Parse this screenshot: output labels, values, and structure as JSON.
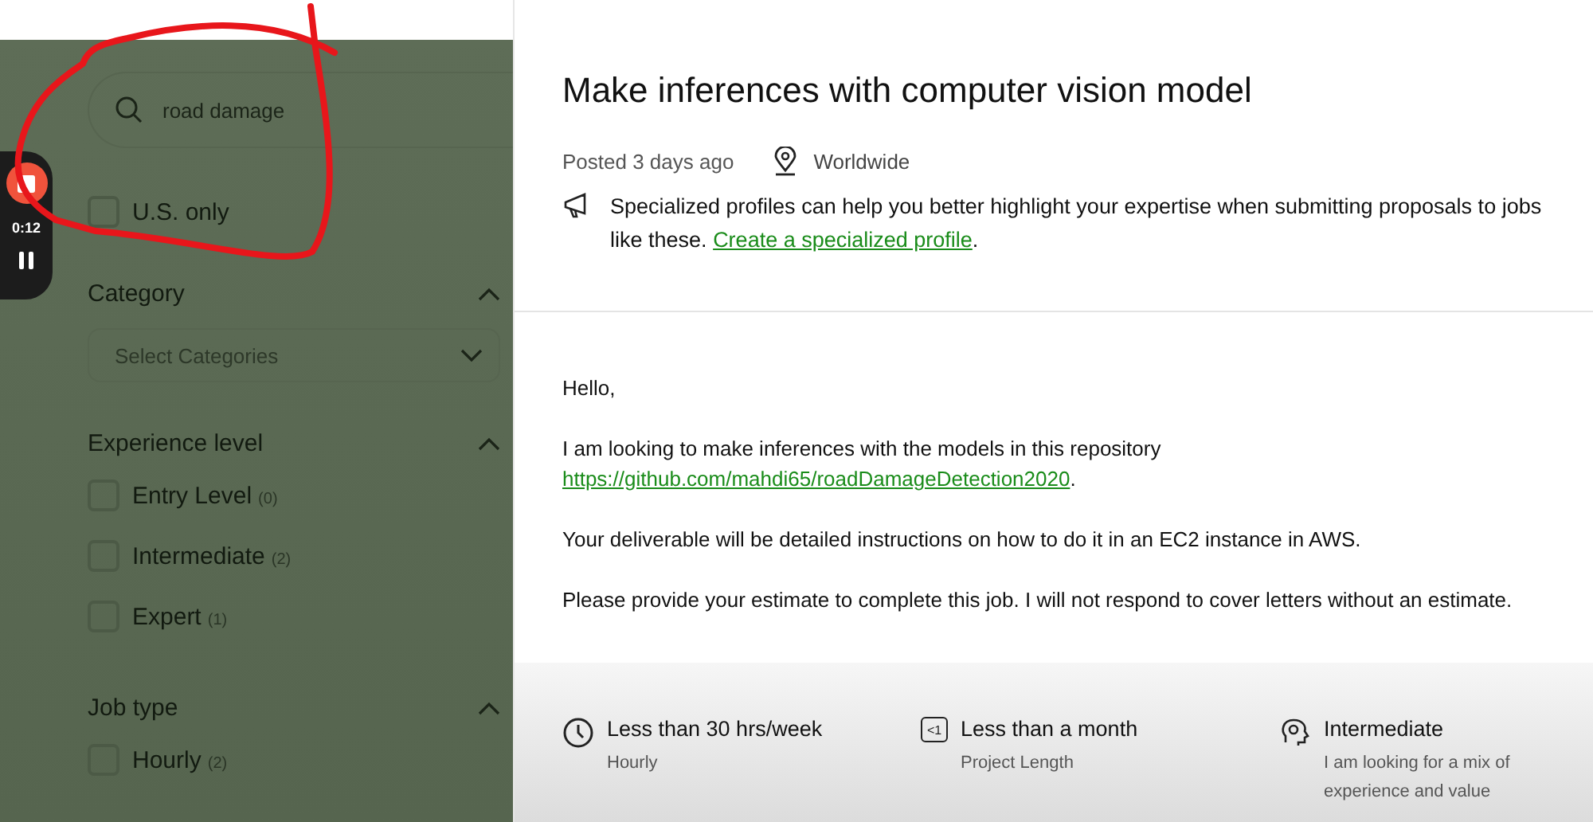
{
  "recorder": {
    "time": "0:12",
    "recording": true
  },
  "filters": {
    "search": {
      "value": "road damage"
    },
    "us_only": {
      "label": "U.S. only",
      "checked": false
    },
    "sections": [
      {
        "title": "Category",
        "expanded": true,
        "kind": "select",
        "placeholder": "Select Categories"
      },
      {
        "title": "Experience level",
        "expanded": true,
        "kind": "checks",
        "options": [
          {
            "label": "Entry Level",
            "count": "(0)",
            "checked": false
          },
          {
            "label": "Intermediate",
            "count": "(2)",
            "checked": false
          },
          {
            "label": "Expert",
            "count": "(1)",
            "checked": false
          }
        ]
      },
      {
        "title": "Job type",
        "expanded": true,
        "kind": "checks",
        "options": [
          {
            "label": "Hourly",
            "count": "(2)",
            "checked": false
          }
        ]
      }
    ]
  },
  "job": {
    "title": "Make inferences with computer vision model",
    "posted": "Posted 3 days ago",
    "location": "Worldwide",
    "tip": {
      "text": "Specialized profiles can help you better highlight your expertise when submitting proposals to jobs like these.",
      "link": "Create a specialized profile",
      "end": "."
    },
    "description": [
      {
        "text": "Hello,"
      },
      {
        "text": "I am looking to make inferences with the models in this repository",
        "link": "https://github.com/mahdi65/roadDamageDetection2020",
        "end": "."
      },
      {
        "text": "Your deliverable will be detailed instructions on how to do it in an EC2 instance in AWS."
      },
      {
        "text": "Please provide your estimate to complete this job. I will not respond to cover letters without an estimate."
      }
    ],
    "features": [
      {
        "kind": "clock",
        "title": "Less than 30 hrs/week",
        "subtitle": "Hourly"
      },
      {
        "kind": "calendar",
        "badge": "<1",
        "title": "Less than a month",
        "subtitle": "Project Length"
      },
      {
        "kind": "brain",
        "title": "Intermediate",
        "subtitle": "I am looking for a mix of experience and value"
      }
    ]
  }
}
